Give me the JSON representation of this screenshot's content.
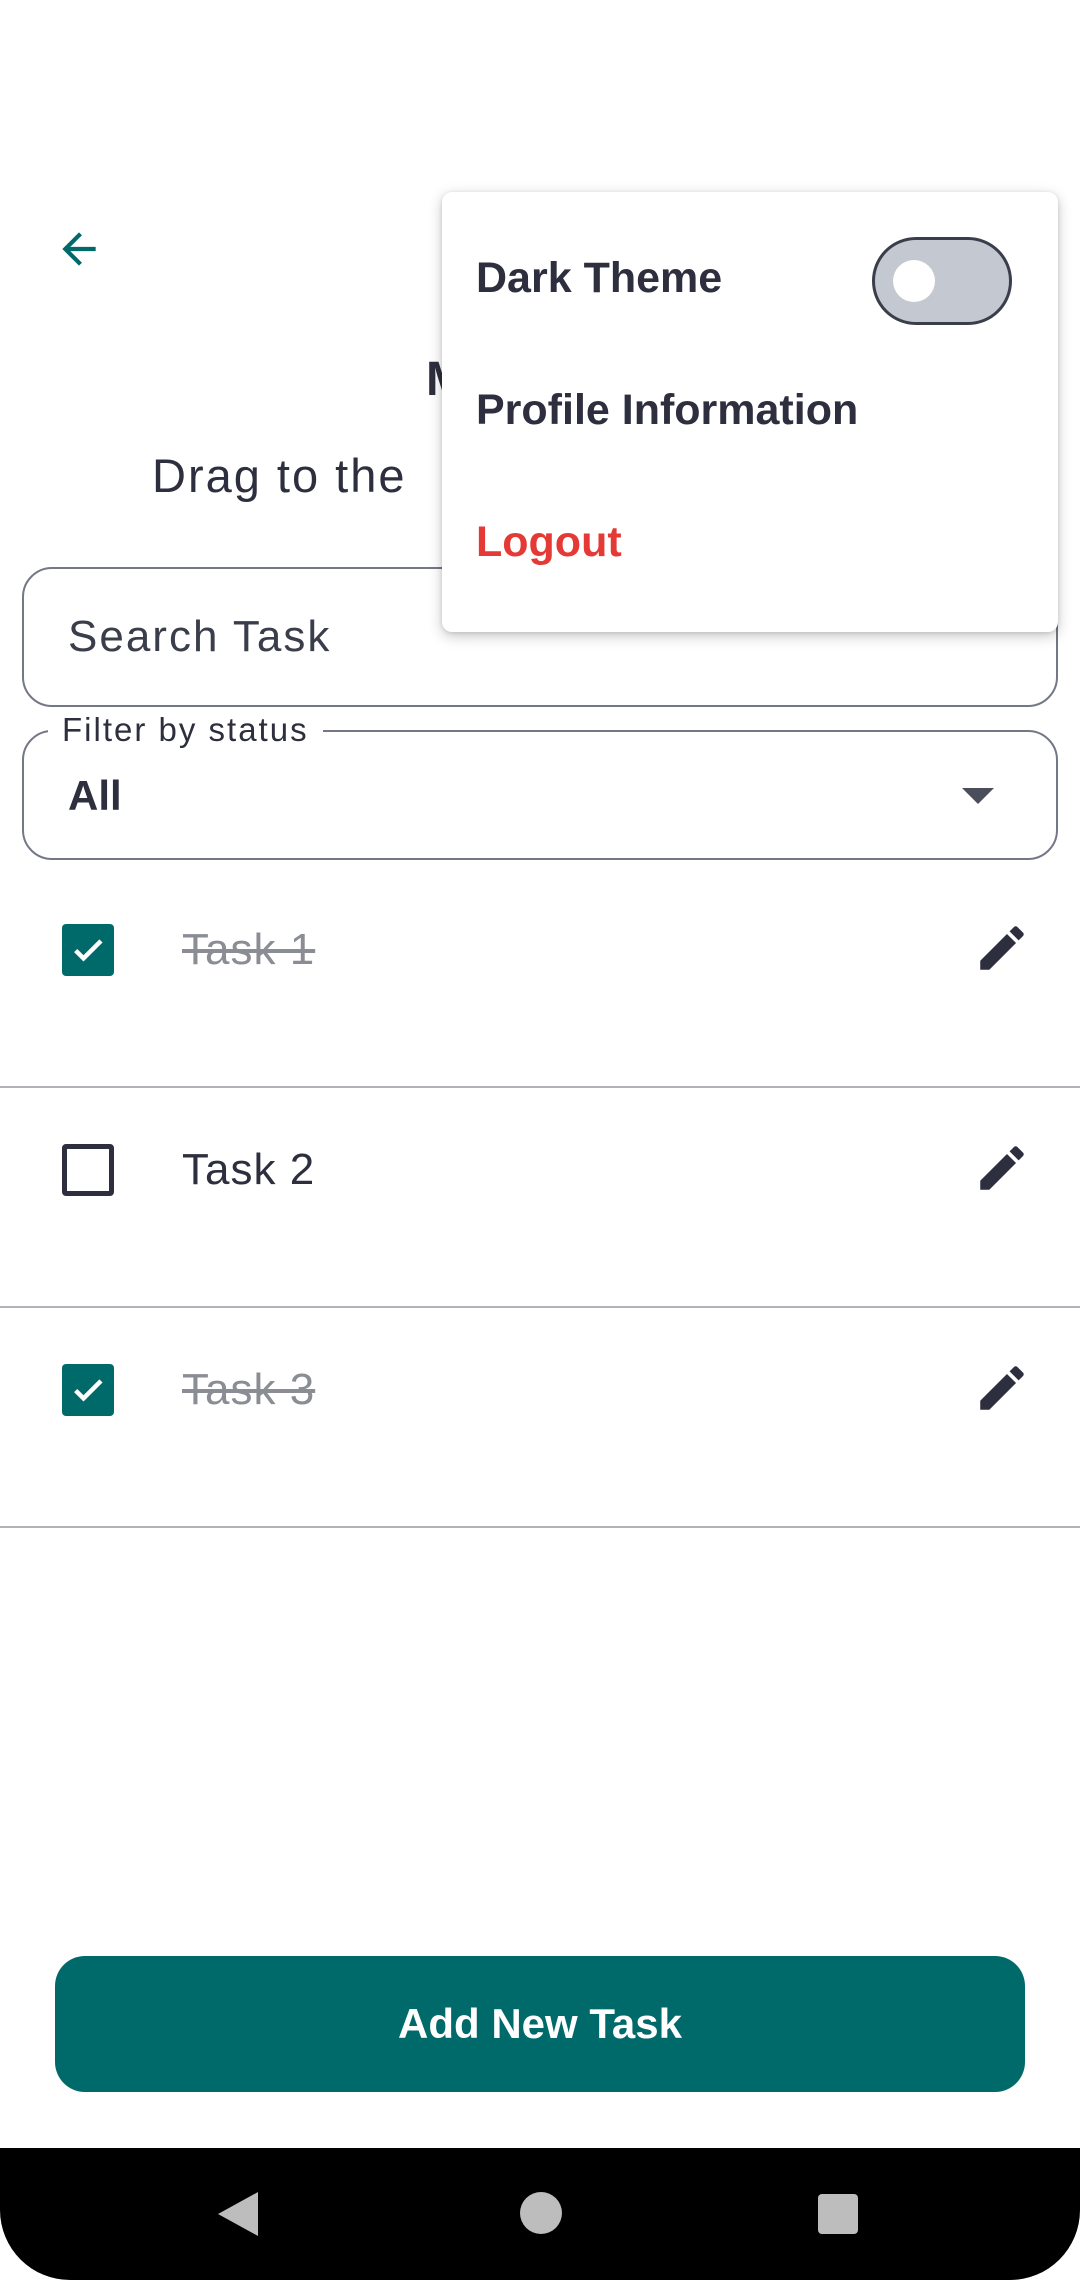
{
  "header": {
    "back_icon": "arrow-back-icon",
    "title_partial": "M",
    "subtitle": "Drag to the"
  },
  "search": {
    "placeholder": "Search Task",
    "value": ""
  },
  "filter": {
    "label": "Filter by status",
    "selected": "All",
    "icon": "caret-down-icon"
  },
  "tasks": [
    {
      "title": "Task 1",
      "completed": true
    },
    {
      "title": "Task 2",
      "completed": false
    },
    {
      "title": "Task 3",
      "completed": true
    }
  ],
  "add_button": {
    "label": "Add New Task"
  },
  "menu": {
    "dark_theme_label": "Dark Theme",
    "dark_theme_on": false,
    "profile_label": "Profile Information",
    "logout_label": "Logout"
  },
  "colors": {
    "accent": "#006a6a",
    "text": "#2d2f3e",
    "logout": "#e53935",
    "toggle_off": "#c4c8d0"
  },
  "navbar": {
    "icons": [
      "nav-back-icon",
      "nav-home-icon",
      "nav-recents-icon"
    ]
  }
}
